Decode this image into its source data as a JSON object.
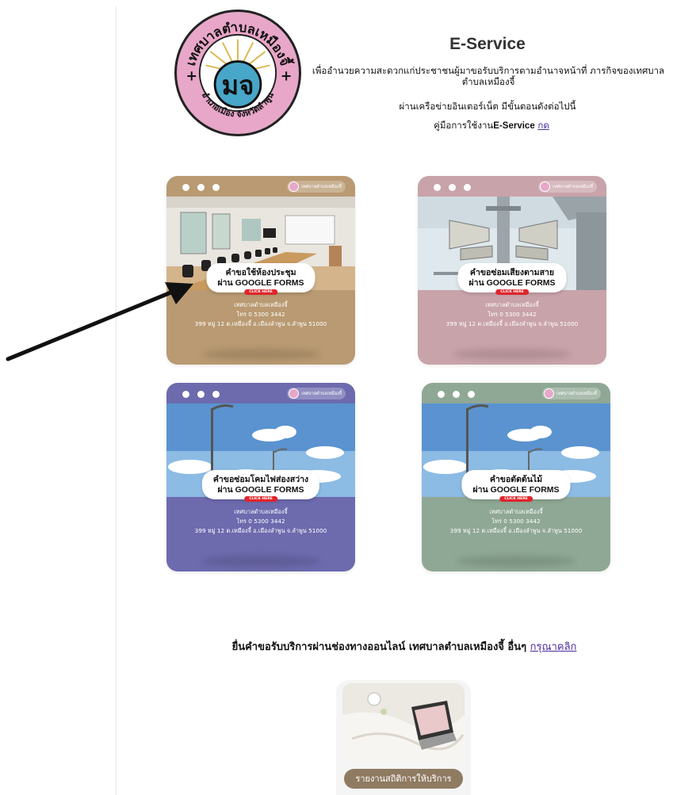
{
  "header": {
    "title": "E-Service",
    "description": "เพื่ออำนวยความสะดวกแก่ประชาชนผู้มาขอรับบริการตามอำนาจหน้าที่ ภารกิจของเทศบาลตำบลเหมืองจี้",
    "line3": "ผ่านเครือข่ายอินเตอร์เน็ต มีขั้นตอนดังต่อไปนี้",
    "manual_prefix": "คู่มือการใช้งาน",
    "manual_bold": "E-Service",
    "manual_link": "กด",
    "seal": {
      "top_text": "เทศบาลตำบลเหมืองจี้",
      "bottom_text": "อำเภอเมือง จังหวัดลำพูน",
      "center_text": "มจ"
    }
  },
  "cards": [
    {
      "title": "คำขอใช้ห้องประชุม",
      "subtitle": "ผ่าน GOOGLE FORMS",
      "click": "CLICK HERE",
      "brand": "เทศบาลตำบลเหมืองจี้",
      "org": "เทศบาลตำบลเหมืองจี้",
      "phone": "โทร 0 5300 3442",
      "address": "399 หมู่ 12 ต.เหมืองจี้ อ.เมืองลำพูน จ.ลำพูน 51000",
      "color": "#b99a72",
      "photo": "meeting-room"
    },
    {
      "title": "คำขอซ่อมเสียงตามสาย",
      "subtitle": "ผ่าน GOOGLE FORMS",
      "click": "CLICK HERE",
      "brand": "เทศบาลตำบลเหมืองจี้",
      "org": "เทศบาลตำบลเหมืองจี้",
      "phone": "โทร 0 5300 3442",
      "address": "399 หมู่ 12 ต.เหมืองจี้ อ.เมืองลำพูน จ.ลำพูน 51000",
      "color": "#c9a3aa",
      "photo": "loudspeakers"
    },
    {
      "title": "คำขอซ่อมโคมไฟส่องสว่าง",
      "subtitle": "ผ่าน GOOGLE FORMS",
      "click": "CLICK HERE",
      "brand": "เทศบาลตำบลเหมืองจี้",
      "org": "เทศบาลตำบลเหมืองจี้",
      "phone": "โทร 0 5300 3442",
      "address": "399 หมู่ 12 ต.เหมืองจี้ อ.เมืองลำพูน จ.ลำพูน 51000",
      "color": "#6d6aae",
      "photo": "street-lamp"
    },
    {
      "title": "คำขอตัดต้นไม้",
      "subtitle": "ผ่าน GOOGLE FORMS",
      "click": "CLICK HERE",
      "brand": "เทศบาลตำบลเหมืองจี้",
      "org": "เทศบาลตำบลเหมืองจี้",
      "phone": "โทร 0 5300 3442",
      "address": "399 หมู่ 12 ต.เหมืองจี้ อ.เมืองลำพูน จ.ลำพูน 51000",
      "color": "#8fa895",
      "photo": "street-lamp"
    }
  ],
  "other_services": {
    "text": "ยื่นคำขอรับบริการผ่านช่องทางออนไลน์ เทศบาลตำบลเหมืองจี้ อื่นๆ",
    "link": "กรุณาคลิก"
  },
  "stats_card": {
    "label": "รายงานสถิติการให้บริการ",
    "color": "#8f7b62"
  }
}
